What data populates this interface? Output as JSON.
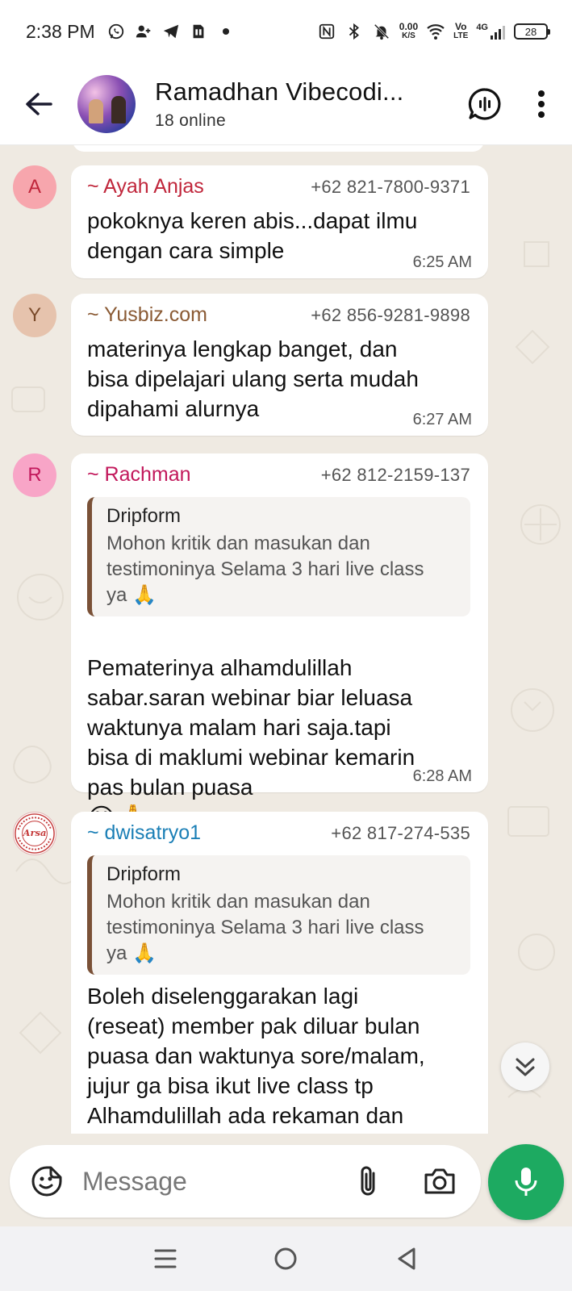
{
  "status_bar": {
    "time": "2:38 PM",
    "net_speed_value": "0.00",
    "net_speed_unit": "K/S",
    "volte_top": "Vo",
    "volte_bottom": "LTE",
    "network": "4G",
    "battery": "28",
    "left_icons": [
      "whatsapp-icon",
      "add-person-icon",
      "telegram-icon",
      "sim-icon",
      "dot-icon"
    ],
    "right_icons": [
      "nfc-icon",
      "bluetooth-icon",
      "mute-bell-icon",
      "wifi-icon",
      "signal-icon",
      "battery-icon"
    ]
  },
  "header": {
    "title": "Ramadhan Vibecodi...",
    "subtitle": "18 online",
    "icons": [
      "back-arrow-icon",
      "group-call-icon",
      "more-vert-icon"
    ]
  },
  "messages": [
    {
      "avatar_letter": "A",
      "avatar_bg": "#f7a6ad",
      "avatar_fg": "#c0263b",
      "sender": "~ Ayah Anjas",
      "sender_color": "#c0263b",
      "phone": "+62 821-7800-9371",
      "text": "pokoknya keren abis...dapat ilmu\ndengan cara simple",
      "time": "6:25 AM"
    },
    {
      "avatar_letter": "Y",
      "avatar_bg": "#e6c3ad",
      "avatar_fg": "#7a4a2a",
      "sender": "~ Yusbiz.com",
      "sender_color": "#8a5a34",
      "phone": "+62 856-9281-9898",
      "text": "materinya lengkap banget, dan\nbisa dipelajari ulang serta mudah\ndipahami alurnya",
      "time": "6:27 AM"
    },
    {
      "avatar_letter": "R",
      "avatar_bg": "#f8a5c7",
      "avatar_fg": "#c2185b",
      "sender": "~ Rachman",
      "sender_color": "#c2185b",
      "phone": "+62 812-2159-137",
      "quote_author": "Dripform",
      "quote_text": "Mohon kritik dan masukan dan\ntestimoninya Selama 3 hari live class\nya 🙏",
      "text": "Pematerinya alhamdulillah\nsabar.saran webinar biar leluasa\nwaktunya malam hari saja.tapi\nbisa di maklumi  webinar kemarin\npas bulan puasa",
      "text_emoji": "😊🙏",
      "time": "6:28 AM"
    },
    {
      "avatar_text": "Arsa",
      "avatar_ring_text": "JASA JAHIT BORDIR",
      "sender": "~ dwisatryo1",
      "sender_color": "#1b7fb6",
      "phone": "+62 817-274-535",
      "quote_author": "Dripform",
      "quote_text": "Mohon kritik dan masukan dan\ntestimoninya Selama 3 hari live class\nya 🙏",
      "text": "Boleh diselenggarakan lagi\n(reseat) member pak diluar bulan\npuasa dan waktunya sore/malam,\njujur ga bisa ikut live class tp\nAlhamdulillah ada rekaman dan"
    }
  ],
  "input": {
    "placeholder": "Message",
    "icons": [
      "sticker-icon",
      "paperclip-icon",
      "camera-icon",
      "mic-icon",
      "chevrons-down-icon"
    ]
  },
  "nav_bar": {
    "icons": [
      "menu-lines-icon",
      "home-circle-icon",
      "back-triangle-icon"
    ]
  },
  "colors": {
    "chat_bg": "#efeae2",
    "accent_green": "#1daa61",
    "quote_bar": "#7a5137"
  }
}
